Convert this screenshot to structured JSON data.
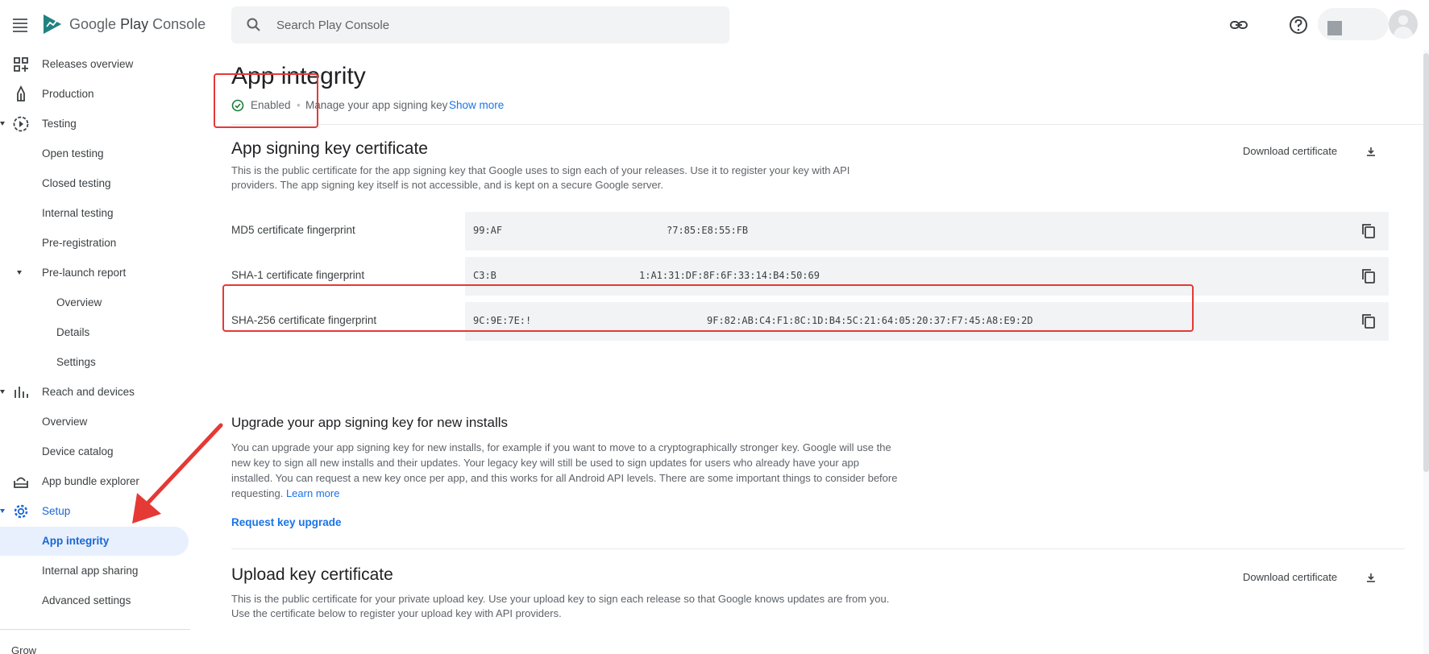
{
  "topbar": {
    "brand_google": "Google",
    "brand_play": "Play",
    "brand_console": "Console",
    "search_placeholder": "Search Play Console",
    "icons": [
      "menu-icon",
      "search-icon",
      "link-icon",
      "help-icon",
      "avatar-icon"
    ]
  },
  "sidebar": {
    "items": [
      {
        "label": "Releases overview",
        "icon": "dashboard-icon"
      },
      {
        "label": "Production",
        "icon": "production-icon"
      },
      {
        "label": "Testing",
        "icon": "testing-icon"
      },
      {
        "label": "Open testing"
      },
      {
        "label": "Closed testing"
      },
      {
        "label": "Internal testing"
      },
      {
        "label": "Pre-registration"
      },
      {
        "label": "Pre-launch report"
      },
      {
        "label": "Overview"
      },
      {
        "label": "Details"
      },
      {
        "label": "Settings"
      },
      {
        "label": "Reach and devices",
        "icon": "bar-chart-icon"
      },
      {
        "label": "Overview"
      },
      {
        "label": "Device catalog"
      },
      {
        "label": "App bundle explorer",
        "icon": "bundle-icon"
      },
      {
        "label": "Setup",
        "icon": "gear-icon"
      },
      {
        "label": "App integrity"
      },
      {
        "label": "Internal app sharing"
      },
      {
        "label": "Advanced settings"
      }
    ],
    "grow_label": "Grow",
    "active_item": "App integrity"
  },
  "main": {
    "title": "App integrity",
    "status": {
      "enabled": "Enabled",
      "separator": "•",
      "manage": "Manage your app signing key",
      "show_more": "Show more"
    },
    "signing": {
      "title": "App signing key certificate",
      "description": "This is the public certificate for the app signing key that Google uses to sign each of your releases. Use it to register your key with API providers. The app signing key itself is not accessible, and is kept on a secure Google server.",
      "download_label": "Download certificate",
      "fingerprints": [
        {
          "label": "MD5 certificate fingerprint",
          "value_start": "99:AF",
          "value_end": "?7:85:E8:55:FB"
        },
        {
          "label": "SHA-1 certificate fingerprint",
          "value_start": "C3:B",
          "value_end": "1:A1:31:DF:8F:6F:33:14:B4:50:69"
        },
        {
          "label": "SHA-256 certificate fingerprint",
          "value_start": "9C:9E:7E:!",
          "value_end": "9F:82:AB:C4:F1:8C:1D:B4:5C:21:64:05:20:37:F7:45:A8:E9:2D"
        }
      ]
    },
    "upgrade": {
      "title": "Upgrade your app signing key for new installs",
      "description": "You can upgrade your app signing key for new installs, for example if you want to move to a cryptographically stronger key. Google will use the new key to sign all new installs and their updates. Your legacy key will still be used to sign updates for users who already have your app installed. You can request a new key once per app, and this works for all Android API levels. There are some important things to consider before requesting.",
      "learn_more": "Learn more",
      "request_label": "Request key upgrade"
    },
    "upload": {
      "title": "Upload key certificate",
      "description": "This is the public certificate for your private upload key. Use your upload key to sign each release so that Google knows updates are from you. Use the certificate below to register your upload key with API providers.",
      "download_label": "Download certificate"
    }
  },
  "colors": {
    "accent": "#1a73e8",
    "active_bg": "#e8f0fe",
    "annotation": "#e53935",
    "success": "#188038"
  }
}
